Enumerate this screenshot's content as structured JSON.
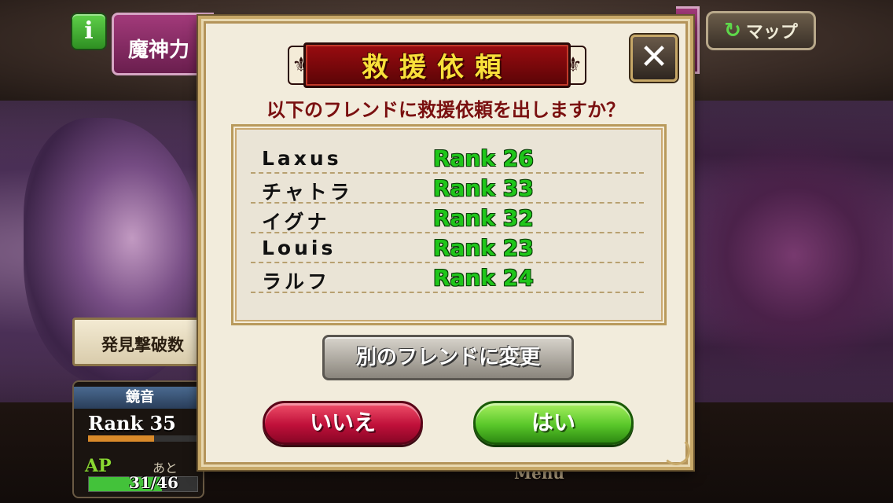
{
  "background": {
    "area_title": "魔神力",
    "map_button": "マップ",
    "discover_label": "発見撃破数",
    "menu_label": "Menu",
    "player": {
      "name": "鏡音",
      "rank": "Rank 35",
      "rank_progress": 0.6,
      "ap_label": "AP",
      "ato_label": "あと",
      "ap_value": "31/46",
      "ap_progress": 0.674
    }
  },
  "dialog": {
    "title": "救援依頼",
    "question": "以下のフレンドに救援依頼を出しますか？",
    "friends": [
      {
        "name": "Laxus",
        "rank": "Rank 26"
      },
      {
        "name": "チャトラ",
        "rank": "Rank 33"
      },
      {
        "name": "イグナ",
        "rank": "Rank 32"
      },
      {
        "name": "Louis",
        "rank": "Rank 23"
      },
      {
        "name": "ラルフ",
        "rank": "Rank 24"
      }
    ],
    "change_button": "別のフレンドに変更",
    "no_button": "いいえ",
    "yes_button": "はい"
  },
  "colors": {
    "rank_green": "#1fc61a",
    "title_yellow": "#f8e03a",
    "question_red": "#7a1010",
    "no_red": "#c0103a",
    "yes_green": "#5ac82a"
  },
  "icons": {
    "info": "info-icon",
    "refresh": "refresh-arrow-icon",
    "close": "close-icon"
  }
}
